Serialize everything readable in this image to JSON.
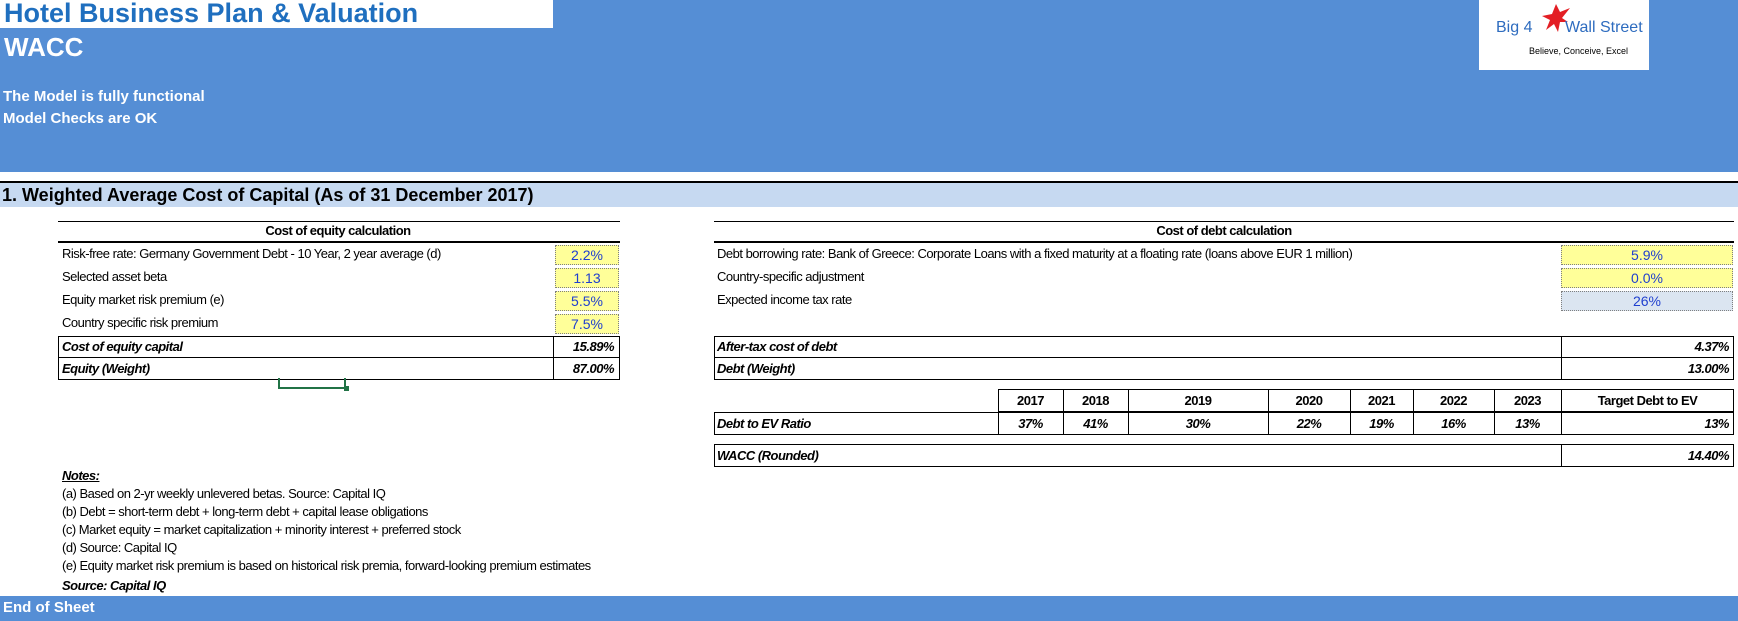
{
  "app_title": "Hotel Business Plan & Valuation",
  "sheet_title": "WACC",
  "status": [
    "The Model is fully functional",
    "Model Checks are OK"
  ],
  "logo": {
    "left": "Big 4",
    "right": "Wall Street",
    "tagline": "Believe, Conceive, Excel",
    "icon": "eagle-icon",
    "color": "#e31e24"
  },
  "section_title": "1. Weighted Average Cost of Capital (As of 31 December 2017)",
  "equity": {
    "heading": "Cost of equity calculation",
    "rows": [
      {
        "label": "Risk-free rate: Germany Government Debt - 10 Year, 2 year average (d)",
        "value": "2.2%"
      },
      {
        "label": "Selected asset beta",
        "value": "1.13"
      },
      {
        "label": "Equity market risk premium (e)",
        "value": "5.5%"
      },
      {
        "label": "Country specific risk premium",
        "value": "7.5%"
      }
    ],
    "total_label": "Cost of equity capital",
    "total_value": "15.89%",
    "weight_label": "Equity (Weight)",
    "weight_value": "87.00%"
  },
  "debt": {
    "heading": "Cost of debt calculation",
    "rows": [
      {
        "label": "Debt borrowing rate: Bank of Greece: Corporate Loans with a fixed maturity at a floating rate (loans above EUR 1 million)",
        "value": "5.9%"
      },
      {
        "label": "Country-specific adjustment",
        "value": "0.0%"
      },
      {
        "label": "Expected income tax rate",
        "value": "26%"
      }
    ],
    "after_tax_label": "After-tax cost of debt",
    "after_tax_value": "4.37%",
    "weight_label": "Debt (Weight)",
    "weight_value": "13.00%"
  },
  "ratio": {
    "label": "Debt to EV Ratio",
    "years": [
      "2017",
      "2018",
      "2019",
      "2020",
      "2021",
      "2022",
      "2023"
    ],
    "values": [
      "37%",
      "41%",
      "30%",
      "22%",
      "19%",
      "16%",
      "13%"
    ],
    "target_label": "Target Debt to EV",
    "target_value": "13%"
  },
  "wacc": {
    "label": "WACC (Rounded)",
    "value": "14.40%"
  },
  "notes": {
    "title": "Notes:",
    "items": [
      "(a) Based on 2-yr weekly unlevered betas. Source: Capital IQ",
      "(b) Debt = short-term debt + long-term debt + capital lease obligations",
      "(c) Market equity = market capitalization + minority interest + preferred stock",
      "(d) Source: Capital IQ",
      "(e) Equity market risk premium is based on historical risk premia, forward-looking premium estimates"
    ],
    "source": "Source: Capital IQ"
  },
  "footer": "End of Sheet"
}
